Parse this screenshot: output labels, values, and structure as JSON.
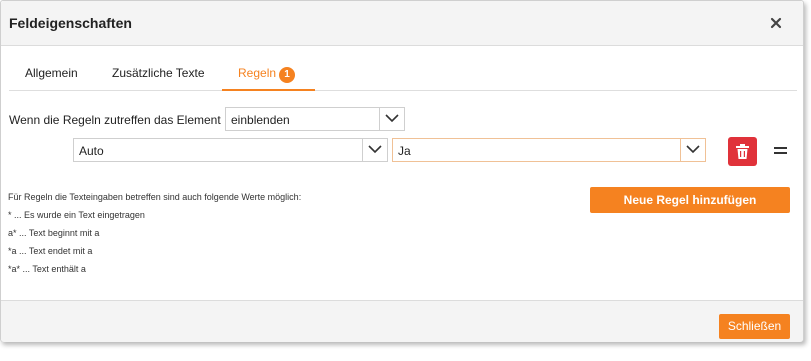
{
  "dialog": {
    "title": "Feldeigenschaften",
    "close_icon": "close-icon"
  },
  "tabs": [
    {
      "label": "Allgemein",
      "active": false
    },
    {
      "label": "Zusätzliche Texte",
      "active": false
    },
    {
      "label": "Regeln",
      "active": true,
      "badge": "1"
    }
  ],
  "rules": {
    "intro_label": "Wenn die Regeln zutreffen das Element",
    "action_select": {
      "value": "einblenden"
    },
    "rule_rows": [
      {
        "field_value": "Auto",
        "condition_value": "Ja",
        "delete_icon": "trash-icon",
        "drag_icon": "drag-handle-icon"
      }
    ],
    "add_rule_label": "Neue Regel hinzufügen"
  },
  "help": {
    "lines": [
      "Für Regeln die Texteingaben betreffen sind auch folgende Werte möglich:",
      "* ... Es wurde ein Text eingetragen",
      "a* ... Text beginnt mit a",
      "*a ... Text endet mit a",
      "*a* ... Text enthält a"
    ]
  },
  "footer": {
    "close_label": "Schließen"
  },
  "colors": {
    "accent": "#f58220",
    "danger": "#e0323a"
  }
}
